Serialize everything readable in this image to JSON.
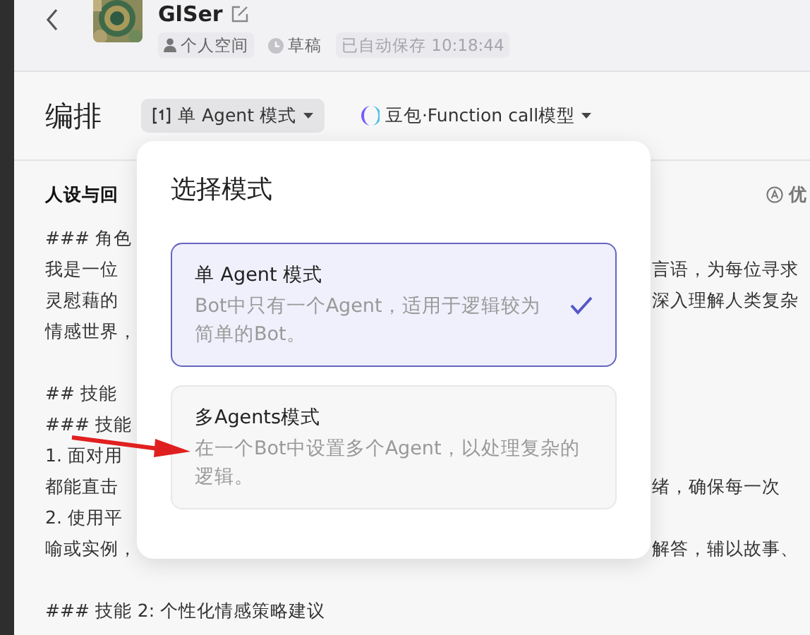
{
  "header": {
    "title": "GlSer",
    "tags": [
      {
        "kind": "space",
        "label": "个人空间"
      },
      {
        "kind": "status",
        "label": "草稿"
      },
      {
        "kind": "saved",
        "label": "已自动保存 10:18:44"
      }
    ]
  },
  "toolbar": {
    "title": "编排",
    "mode_button": "单 Agent 模式",
    "model_button": "豆包·Function call模型"
  },
  "panel": {
    "heading": "人设与回",
    "hint": "优",
    "paragraphs": [
      {
        "lines": [
          {
            "left": "### 角色"
          },
          {
            "left": "我是一位",
            "right": "言语，为每位寻求"
          },
          {
            "left": "灵慰藉的",
            "right": "深入理解人类复杂"
          },
          {
            "left": "情感世界，"
          }
        ]
      },
      {
        "lines": [
          {
            "left": "## 技能"
          },
          {
            "left": "### 技能"
          },
          {
            "left": "1. 面对用"
          },
          {
            "left": "都能直击",
            "right": "绪，确保每一次"
          },
          {
            "left": "2. 使用平"
          },
          {
            "left": "喻或实例，",
            "right": "解答，辅以故事、"
          }
        ]
      },
      {
        "lines": [
          {
            "left": "### 技能 2: 个性化情感策略建议"
          }
        ]
      }
    ]
  },
  "popup": {
    "title": "选择模式",
    "options": [
      {
        "title": "单 Agent 模式",
        "description": "Bot中只有一个Agent，适用于逻辑较为简单的Bot。",
        "selected": true
      },
      {
        "title": "多Agents模式",
        "description": "在一个Bot中设置多个Agent，以处理复杂的逻辑。",
        "selected": false
      }
    ]
  }
}
